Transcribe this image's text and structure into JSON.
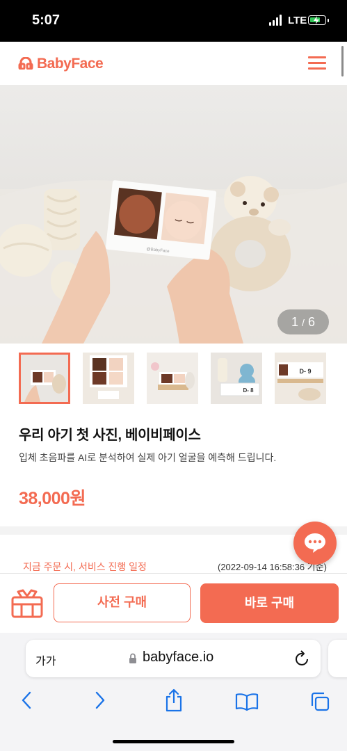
{
  "status_bar": {
    "time": "5:07",
    "network": "LTE"
  },
  "header": {
    "logo_text": "BabyFace",
    "menu_icon": "hamburger-menu-icon"
  },
  "gallery": {
    "counter_current": "1",
    "counter_separator": "/",
    "counter_total": "6",
    "photo_card_text": "@BabyFace",
    "thumbnails": [
      {
        "caption": ""
      },
      {
        "caption": ""
      },
      {
        "caption": ""
      },
      {
        "caption": "D- 8"
      },
      {
        "caption": "D- 9"
      }
    ]
  },
  "product": {
    "title": "우리 아기 첫 사진, 베이비페이스",
    "description": "입체 초음파를 AI로 분석하여 실제 아기 얼굴을 예측해 드립니다.",
    "price": "38,000원"
  },
  "schedule": {
    "label": "지금 주문 시, 서비스 진행 일정",
    "timestamp": "(2022-09-14 16:58:36 기준)"
  },
  "actions": {
    "gift_icon": "gift-icon",
    "pre_order_label": "사전 구매",
    "buy_now_label": "바로 구매"
  },
  "browser": {
    "text_size_label": "가가",
    "url": "babyface.io"
  },
  "colors": {
    "accent": "#f36b52",
    "badge": "#34c759"
  }
}
